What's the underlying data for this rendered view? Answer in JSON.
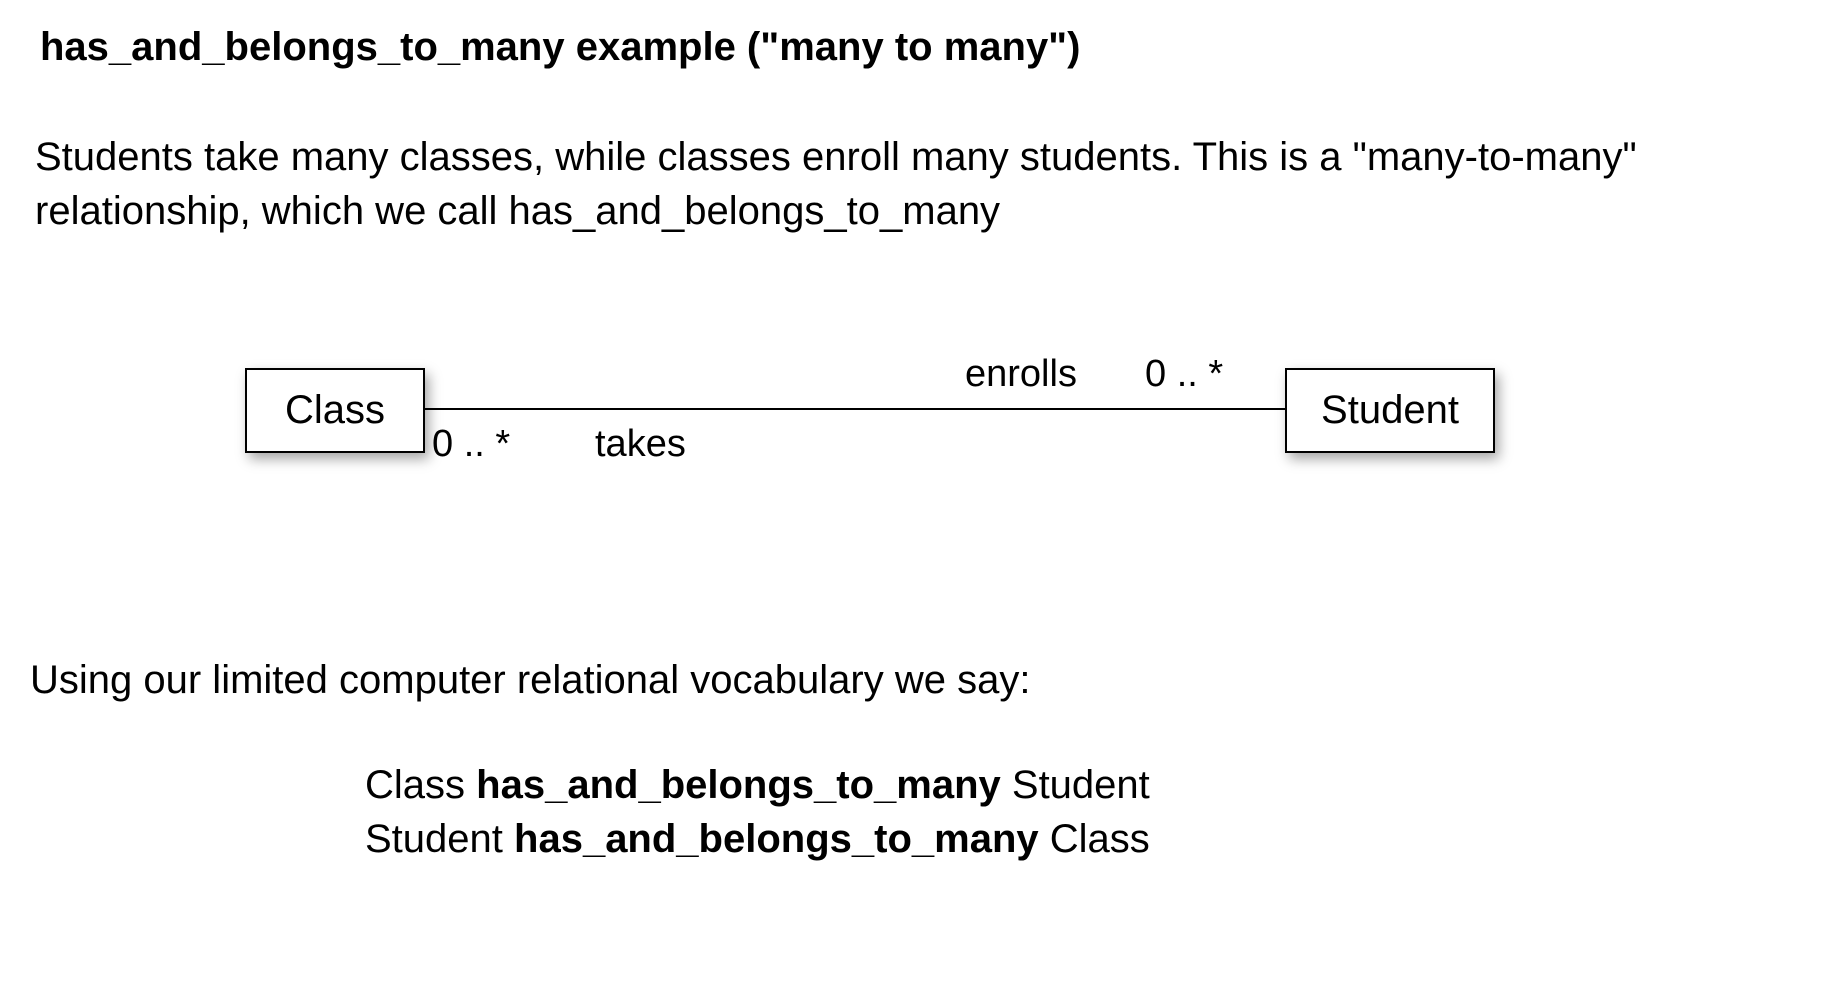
{
  "title": "has_and_belongs_to_many example  (\"many to many\")",
  "description": "Students take many classes, while classes enroll many students.  This is a \"many-to-many\" relationship, which we call has_and_belongs_to_many",
  "diagram": {
    "left_entity": "Class",
    "right_entity": "Student",
    "left_multiplicity": "0 .. *",
    "left_role": "takes",
    "right_role": "enrolls",
    "right_multiplicity": "0 .. *"
  },
  "vocab_intro": "Using our limited computer relational vocabulary we say:",
  "statements": [
    {
      "subject": "Class",
      "relation": "has_and_belongs_to_many",
      "object": "Student"
    },
    {
      "subject": "Student",
      "relation": "has_and_belongs_to_many",
      "object": "Class"
    }
  ]
}
